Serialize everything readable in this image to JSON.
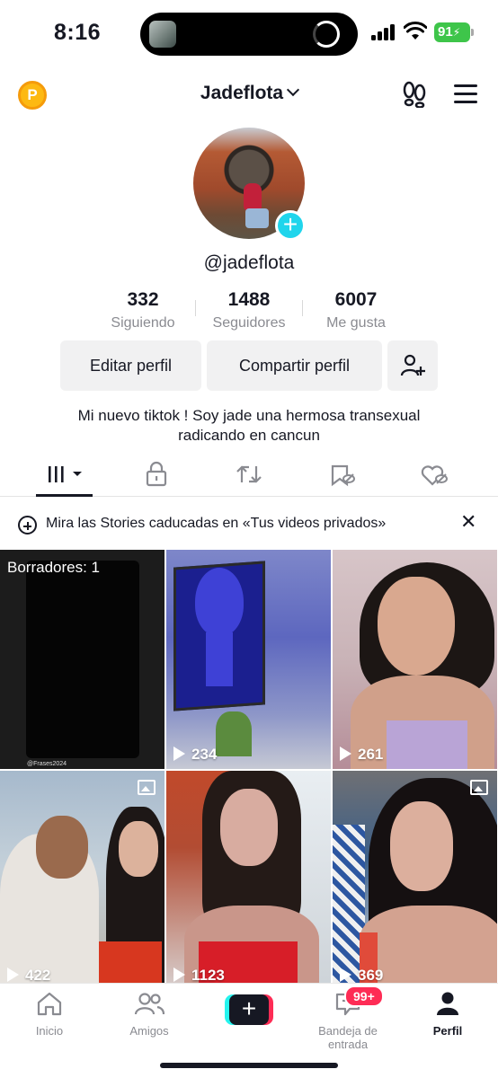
{
  "status_bar": {
    "time": "8:16",
    "battery": "91"
  },
  "header": {
    "coin_label": "P",
    "username": "Jadeflota"
  },
  "profile": {
    "handle": "@jadeflota",
    "stats": [
      {
        "value": "332",
        "label": "Siguiendo"
      },
      {
        "value": "1488",
        "label": "Seguidores"
      },
      {
        "value": "6007",
        "label": "Me gusta"
      }
    ],
    "edit_button": "Editar perfil",
    "share_button": "Compartir perfil",
    "bio_line1": "Mi nuevo tiktok ! Soy jade una hermosa transexual",
    "bio_line2": "radicando en cancun"
  },
  "tabs": [
    {
      "icon": "grid-icon",
      "active": true
    },
    {
      "icon": "lock-icon"
    },
    {
      "icon": "repost-icon"
    },
    {
      "icon": "bookmark-eye-icon"
    },
    {
      "icon": "heart-eye-icon"
    }
  ],
  "banner": {
    "text": "Mira las Stories caducadas en «Tus videos privados»",
    "close": "✕"
  },
  "grid": {
    "drafts_label": "Borradores: 1",
    "draft_watermark": "@Frases2024",
    "videos": [
      {
        "views": "234"
      },
      {
        "views": "261"
      },
      {
        "views": "422",
        "photo": true
      },
      {
        "views": "1123"
      },
      {
        "views": "369",
        "photo": true
      }
    ]
  },
  "bottom_nav": {
    "items": [
      {
        "label": "Inicio",
        "icon": "home-icon"
      },
      {
        "label": "Amigos",
        "icon": "friends-icon"
      },
      {
        "label": "",
        "icon": "create-icon"
      },
      {
        "label": "Bandeja de entrada",
        "icon": "inbox-icon",
        "badge": "99+"
      },
      {
        "label": "Perfil",
        "icon": "profile-icon",
        "active": true
      }
    ]
  },
  "colors": {
    "accent_cyan": "#20d5ec",
    "accent_red": "#fe2c55",
    "battery_green": "#3ec54a",
    "coin_gold": "#fdb912"
  }
}
